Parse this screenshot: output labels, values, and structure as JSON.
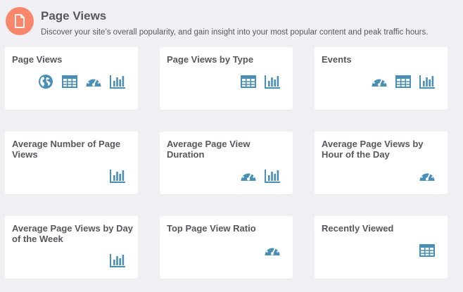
{
  "header": {
    "icon": "document-icon",
    "title": "Page Views",
    "description": "Discover your site’s overall popularity, and gain insight into your most popular content and peak traffic hours."
  },
  "colors": {
    "icon_blue": "#4a8fb5",
    "header_badge": "#f7866b",
    "text": "#55585e",
    "background": "#f0f0f4",
    "card": "#ffffff"
  },
  "cards": [
    {
      "title": "Page Views",
      "icons": [
        "globe-icon",
        "table-icon",
        "gauge-icon",
        "bar-chart-icon"
      ]
    },
    {
      "title": "Page Views by Type",
      "icons": [
        "table-icon",
        "bar-chart-icon"
      ]
    },
    {
      "title": "Events",
      "icons": [
        "gauge-icon",
        "table-icon",
        "bar-chart-icon"
      ]
    },
    {
      "title": "Average Number of Page Views",
      "icons": [
        "bar-chart-icon"
      ]
    },
    {
      "title": "Average Page View Duration",
      "icons": [
        "gauge-icon",
        "bar-chart-icon"
      ]
    },
    {
      "title": "Average Page Views by Hour of the Day",
      "icons": [
        "gauge-icon"
      ]
    },
    {
      "title": "Average Page Views by Day of the Week",
      "icons": [
        "bar-chart-icon"
      ]
    },
    {
      "title": "Top Page View Ratio",
      "icons": [
        "gauge-icon"
      ]
    },
    {
      "title": "Recently Viewed",
      "icons": [
        "table-icon"
      ]
    }
  ]
}
